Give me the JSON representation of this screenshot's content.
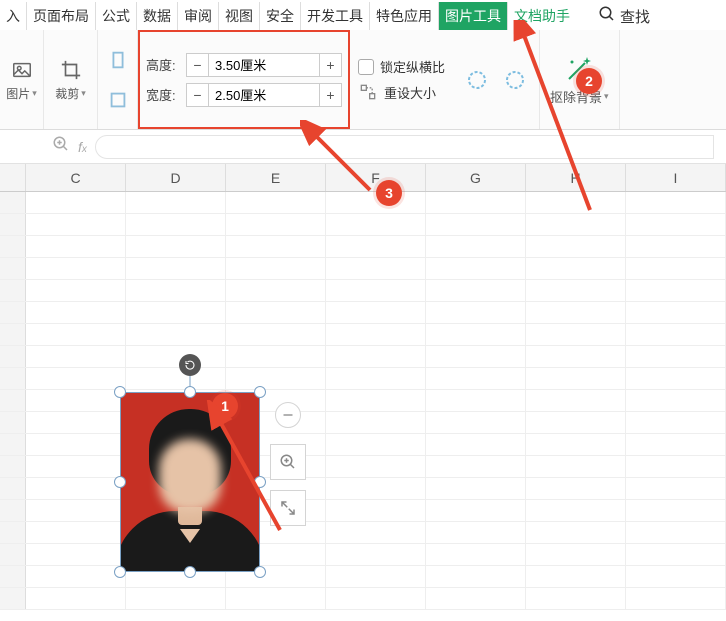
{
  "menu": {
    "tabs": [
      "入",
      "页面布局",
      "公式",
      "数据",
      "审阅",
      "视图",
      "安全",
      "开发工具",
      "特色应用",
      "图片工具",
      "文档助手"
    ],
    "active_tab": "图片工具",
    "assist_tab": "文档助手",
    "search_label": "查找"
  },
  "ribbon": {
    "group_image": "图片",
    "group_crop": "裁剪",
    "height_label": "高度:",
    "width_label": "宽度:",
    "height_value": "3.50厘米",
    "width_value": "2.50厘米",
    "lock_ratio": "锁定纵横比",
    "reset_size": "重设大小",
    "remove_bg": "抠除背景"
  },
  "columns": [
    "",
    "C",
    "D",
    "E",
    "F",
    "G",
    "H",
    "I"
  ],
  "badges": {
    "b1": "1",
    "b2": "2",
    "b3": "3"
  },
  "stepper": {
    "minus": "−",
    "plus": "+"
  }
}
